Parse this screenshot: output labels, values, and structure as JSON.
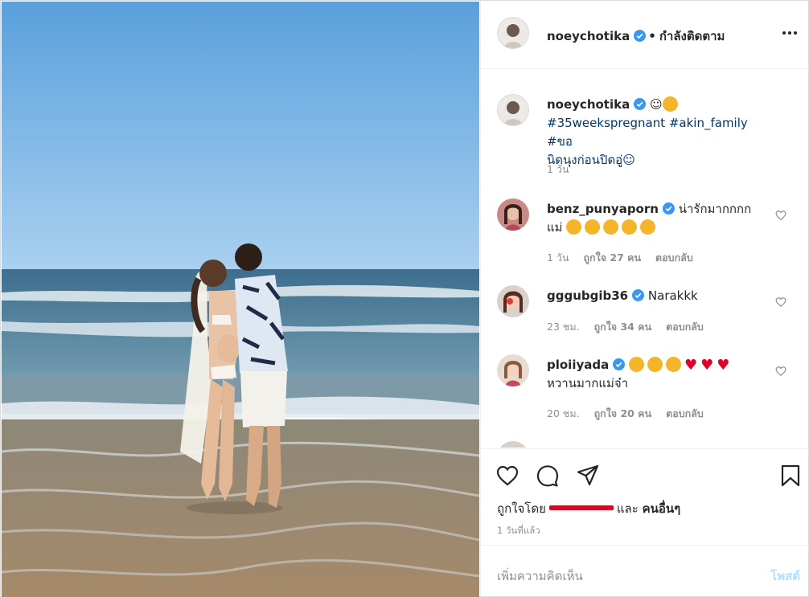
{
  "post": {
    "username": "noeychotika",
    "separator": "•",
    "follow_status": "กำลังติดตาม"
  },
  "caption": {
    "username": "noeychotika",
    "symbol": "☺",
    "hashtags": "#35weekspregnant #akin_family #ขอ",
    "text_line2": "นิดนุงก่อนปิดอู่☺",
    "time": "1 วัน"
  },
  "comments": [
    {
      "username": "benz_punyaporn",
      "text_line1": "น่ารักมากกกก",
      "text_line2": "แม่",
      "time": "1 วัน",
      "likes": "ถูกใจ 27 คน",
      "reply": "ตอบกลับ"
    },
    {
      "username": "gggubgib36",
      "text": "Narakkk",
      "time": "23 ชม.",
      "likes": "ถูกใจ 34 คน",
      "reply": "ตอบกลับ"
    },
    {
      "username": "ploiiyada",
      "text_line2": "หวานมากแม่จ๋า",
      "time": "20 ชม.",
      "likes": "ถูกใจ 20 คน",
      "reply": "ตอบกลับ"
    }
  ],
  "likes_line": {
    "prefix": "ถูกใจโดย",
    "and": "และ",
    "others": "คนอื่นๆ"
  },
  "post_time": "1 วันที่แล้ว",
  "add_comment": {
    "placeholder": "เพิ่มความคิดเห็น",
    "post_label": "โพสต์"
  },
  "colors": {
    "verified": "#3897f0",
    "hashtag": "#00376b",
    "post_button_disabled": "#b2dffc",
    "secondary_text": "#8e8e8e"
  }
}
